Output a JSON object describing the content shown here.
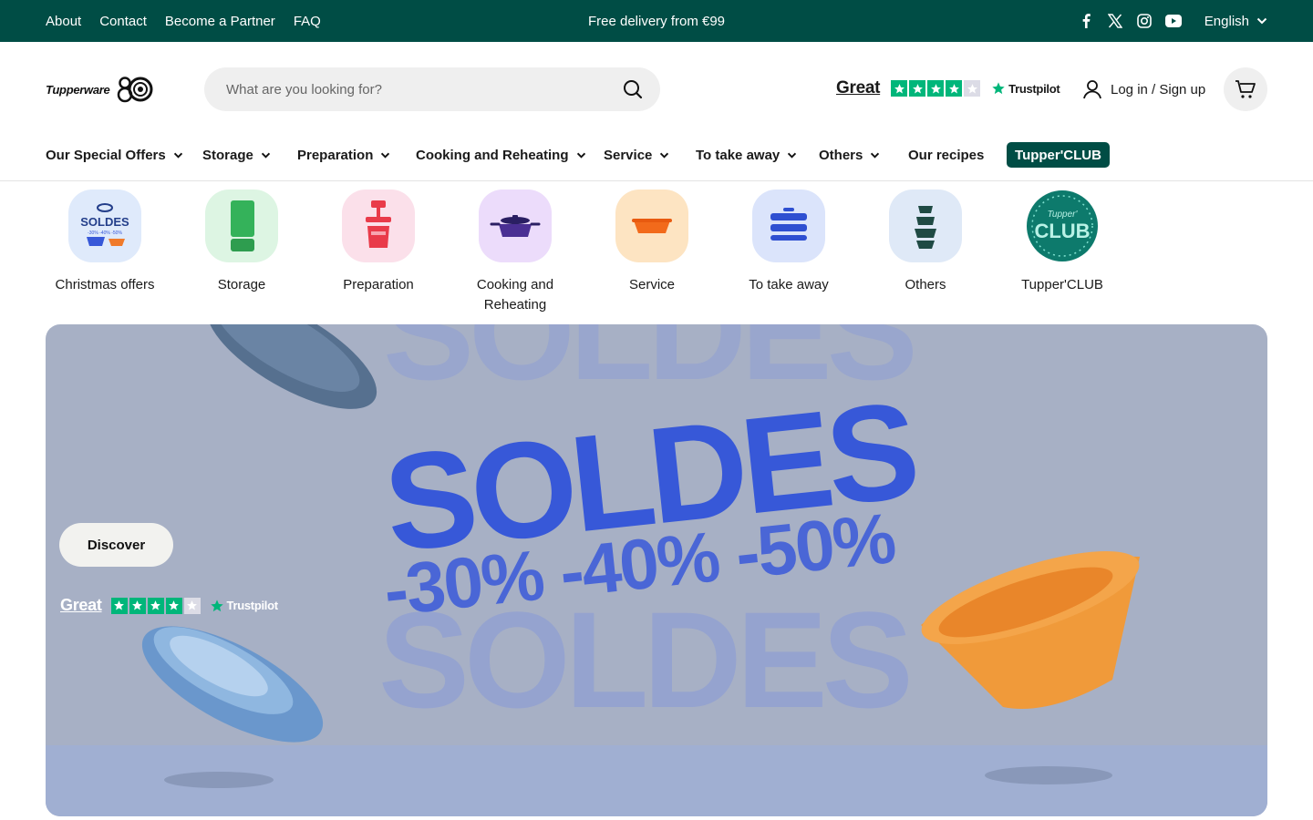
{
  "topbar": {
    "links": [
      "About",
      "Contact",
      "Become a Partner",
      "FAQ"
    ],
    "promo": "Free delivery from €99",
    "social": [
      "facebook-icon",
      "x-twitter-icon",
      "instagram-icon",
      "youtube-icon"
    ],
    "language": "English"
  },
  "header": {
    "logo_text": "Tupperware",
    "search_placeholder": "What are you looking for?",
    "trustpilot": {
      "rating_word": "Great",
      "stars": 4,
      "brand": "Trustpilot"
    },
    "login": "Log in / Sign up"
  },
  "nav": {
    "items": [
      "Our Special Offers",
      "Storage",
      "Preparation",
      "Cooking and Reheating",
      "Service",
      "To take away",
      "Others",
      "Our recipes"
    ],
    "club": "Tupper'CLUB"
  },
  "categories": [
    {
      "label": "Christmas offers",
      "bg": "#dfeafb"
    },
    {
      "label": "Storage",
      "bg": "#ddf5e3"
    },
    {
      "label": "Preparation",
      "bg": "#fbe0ea"
    },
    {
      "label": "Cooking and Reheating",
      "bg": "#ecdcfb"
    },
    {
      "label": "Service",
      "bg": "#fde4c2"
    },
    {
      "label": "To take away",
      "bg": "#dbe4fb"
    },
    {
      "label": "Others",
      "bg": "#dfe9f7"
    },
    {
      "label": "Tupper'CLUB",
      "bg": "#e8f3f1"
    }
  ],
  "category_icon_labels": {
    "soldes": "SOLDES",
    "percents": "-30% -40% -50%",
    "club_top": "Tupper'",
    "club_main": "CLUB"
  },
  "hero": {
    "headline": "SOLDES",
    "percents": "-30% -40% -50%",
    "cta": "Discover",
    "trustpilot": {
      "rating_word": "Great",
      "stars": 4,
      "brand": "Trustpilot"
    }
  },
  "colors": {
    "brand_green": "#004d45",
    "trustpilot_green": "#00b67a",
    "sale_blue": "#3758d8"
  }
}
